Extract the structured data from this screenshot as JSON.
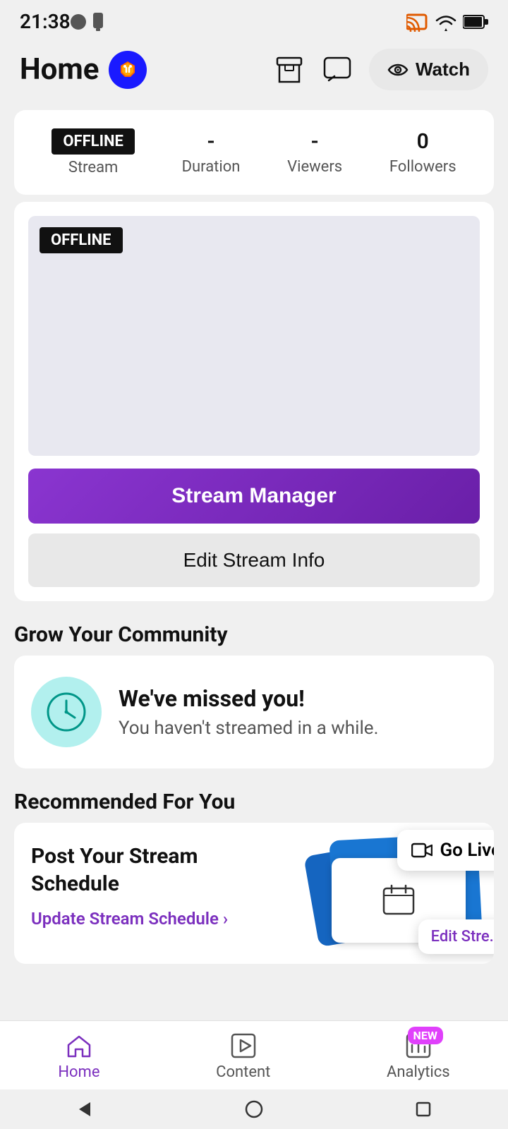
{
  "statusBar": {
    "time": "21:38"
  },
  "header": {
    "title": "Home",
    "watchLabel": "Watch"
  },
  "stats": {
    "streamLabel": "Stream",
    "offlineLabel": "OFFLINE",
    "durationLabel": "Duration",
    "durationValue": "-",
    "viewersLabel": "Viewers",
    "viewersValue": "-",
    "followersLabel": "Followers",
    "followersValue": "0"
  },
  "previewCard": {
    "offlineBadge": "OFFLINE",
    "streamManagerLabel": "Stream Manager",
    "editStreamInfoLabel": "Edit Stream Info"
  },
  "community": {
    "sectionTitle": "Grow Your Community",
    "cardTitle": "We've missed you!",
    "cardSubtitle": "You haven't streamed in a while."
  },
  "recommended": {
    "sectionTitle": "Recommended For You",
    "cardTitle": "Post Your Stream Schedule",
    "updateLink": "Update Stream Schedule",
    "goLiveLabel": "Go Live",
    "editStrePartial": "Edit Stre..."
  },
  "bottomNav": {
    "homeLabel": "Home",
    "contentLabel": "Content",
    "analyticsLabel": "Analytics",
    "newBadge": "NEW"
  }
}
